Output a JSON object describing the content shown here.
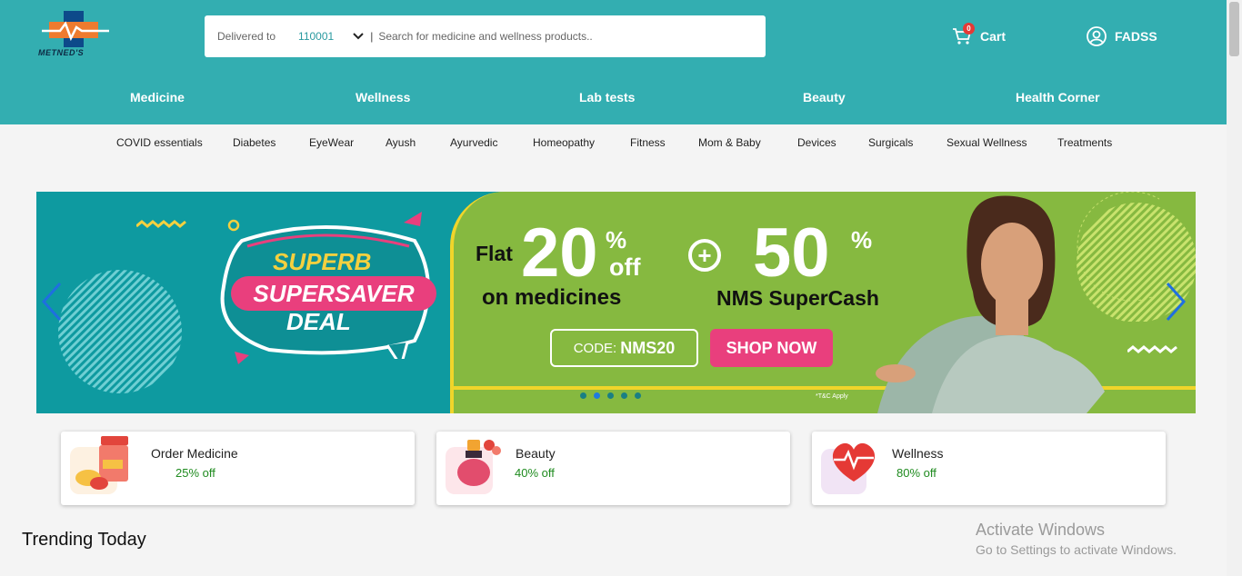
{
  "brand": {
    "logo_text": "METNED'S"
  },
  "search": {
    "delivered_label": "Delivered to",
    "pincode": "110001",
    "separator": "|",
    "placeholder": "Search for medicine and wellness products.."
  },
  "cart": {
    "label": "Cart",
    "count": "0"
  },
  "user": {
    "name": "FADSS"
  },
  "main_nav": [
    "Medicine",
    "Wellness",
    "Lab tests",
    "Beauty",
    "Health Corner"
  ],
  "sub_nav": [
    "COVID essentials",
    "Diabetes",
    "EyeWear",
    "Ayush",
    "Ayurvedic",
    "Homeopathy",
    "Fitness",
    "Mom & Baby",
    "Devices",
    "Surgicals",
    "Sexual Wellness",
    "Treatments"
  ],
  "banner": {
    "superb": "SUPERB",
    "supersaver": "SUPERSAVER",
    "deal": "DEAL",
    "flat": "Flat",
    "big_1": "20",
    "pct_1": "%",
    "off": "off",
    "on_medicines": "on medicines",
    "plus": "+",
    "big_2": "50",
    "pct_2": "%",
    "supercash": "NMS SuperCash",
    "code_label": "CODE:",
    "code_value": "NMS20",
    "shop_now": "SHOP NOW",
    "tc": "*T&C Apply",
    "slide_count": 5,
    "active_slide": 2
  },
  "categories": [
    {
      "title": "Order Medicine",
      "offer": "25% off"
    },
    {
      "title": "Beauty",
      "offer": "40% off"
    },
    {
      "title": "Wellness",
      "offer": "80% off"
    }
  ],
  "section": {
    "trending": "Trending Today"
  },
  "watermark": {
    "line1": "Activate Windows",
    "line2": "Go to Settings to activate Windows."
  },
  "colors": {
    "header": "#33aeb1",
    "banner_teal": "#0e9aa0",
    "banner_green": "#86b940",
    "pink": "#e93f7d",
    "offer_green": "#1f8b1f"
  }
}
